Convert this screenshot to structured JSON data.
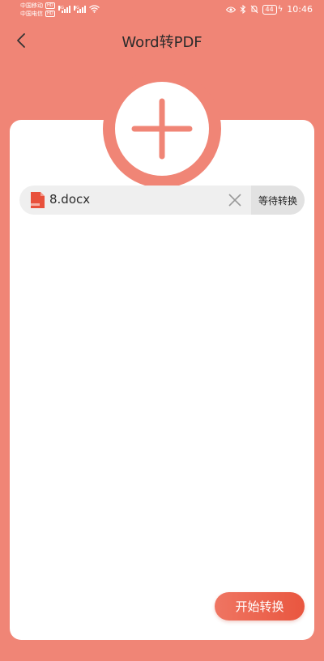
{
  "status_bar": {
    "carrier1": "中国移动",
    "carrier2": "中国电信",
    "hd_label": "HD",
    "signal_tag": "4G",
    "battery": "44",
    "time": "10:46"
  },
  "header": {
    "title": "Word转PDF",
    "back_icon": "chevron-left-icon"
  },
  "add_button": {
    "icon": "plus-icon"
  },
  "file_list": [
    {
      "name": "8.docx",
      "status": "等待转换",
      "icon": "word-file-icon"
    }
  ],
  "actions": {
    "start_label": "开始转换"
  },
  "colors": {
    "background": "#F08576",
    "card": "#FFFFFF",
    "accent": "#E9563F",
    "file_row": "#EFEFEF"
  }
}
